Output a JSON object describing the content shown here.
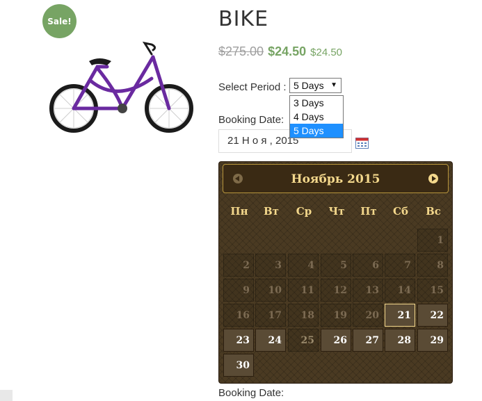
{
  "product": {
    "sale_badge": "Sale!",
    "title": "BIKE",
    "price_old": "$275.00",
    "price_new": "$24.50",
    "price_small": "$24.50"
  },
  "booking": {
    "period_label": "Select Period :",
    "period_value": "5 Days",
    "period_options": [
      "3 Days",
      "4 Days",
      "5 Days"
    ],
    "booking_date_label": "Booking Date:",
    "date_value": "21 Н о я , 2015",
    "booking_date_label_2": "Booking Date:"
  },
  "calendar": {
    "month_title": "Ноябрь 2015",
    "weekdays": [
      "Пн",
      "Вт",
      "Ср",
      "Чт",
      "Пт",
      "Сб",
      "Вс"
    ],
    "weeks": [
      [
        "",
        "",
        "",
        "",
        "",
        "",
        "1"
      ],
      [
        "2",
        "3",
        "4",
        "5",
        "6",
        "7",
        "8"
      ],
      [
        "9",
        "10",
        "11",
        "12",
        "13",
        "14",
        "15"
      ],
      [
        "16",
        "17",
        "18",
        "19",
        "20",
        "21",
        "22"
      ],
      [
        "23",
        "24",
        "25",
        "26",
        "27",
        "28",
        "29"
      ],
      [
        "30",
        "",
        "",
        "",
        "",
        "",
        ""
      ]
    ],
    "today": "21",
    "available": [
      "21",
      "22",
      "23",
      "24",
      "26",
      "27",
      "28",
      "29",
      "30"
    ],
    "dimmed": [
      "25"
    ]
  },
  "colors": {
    "sale_green": "#77a464",
    "calendar_gold": "#f4d88c",
    "calendar_bg": "#4a3a22",
    "dropdown_highlight": "#1e90ff"
  }
}
